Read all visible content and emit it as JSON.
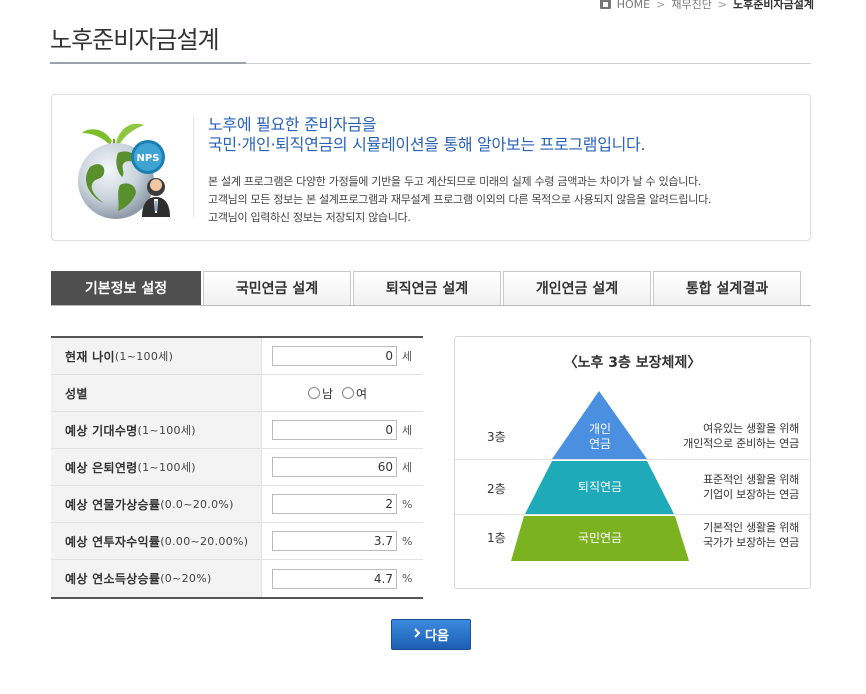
{
  "breadcrumb": {
    "home": "HOME",
    "middle": "재무진단",
    "current": "노후준비자금설계"
  },
  "page_title": "노후준비자금설계",
  "intro": {
    "badge": "NPS",
    "heading_line1": "노후에 필요한 준비자금을",
    "heading_line2": "국민·개인·퇴직연금의 시뮬레이션을 통해 알아보는 프로그램입니다.",
    "desc_line1": "본 설계 프로그램은 다양한 가정들에 기반을 두고 계산되므로 미래의 실제 수령 금액과는 차이가 날 수 있습니다.",
    "desc_line2": "고객님의 모든 정보는 본 설계프로그램과 재무설계 프로그램 이외의 다른 목적으로 사용되지 않음을 알려드립니다.",
    "desc_line3": "고객님이 입력하신 정보는 저장되지 않습니다."
  },
  "tabs": [
    {
      "label": "기본정보 설정",
      "active": true
    },
    {
      "label": "국민연금 설계"
    },
    {
      "label": "퇴직연금 설계"
    },
    {
      "label": "개인연금 설계"
    },
    {
      "label": "통합 설계결과"
    }
  ],
  "form": {
    "current_age": {
      "label": "현재 나이",
      "range": "(1~100세)",
      "value": "0",
      "unit": "세"
    },
    "gender": {
      "label": "성별",
      "male": "남",
      "female": "여"
    },
    "life_expectancy": {
      "label": "예상 기대수명",
      "range": "(1~100세)",
      "value": "0",
      "unit": "세"
    },
    "retire_age": {
      "label": "예상 은퇴연령",
      "range": "(1~100세)",
      "value": "60",
      "unit": "세"
    },
    "inflation": {
      "label": "예상 연물가상승률",
      "range": "(0.0~20.0%)",
      "value": "2",
      "unit": "%"
    },
    "return_rate": {
      "label": "예상 연투자수익률",
      "range": "(0.00~20.00%)",
      "value": "3.7",
      "unit": "%"
    },
    "income_growth": {
      "label": "예상 연소득상승률",
      "range": "(0~20%)",
      "value": "4.7",
      "unit": "%"
    }
  },
  "pyramid": {
    "title": "〈노후 3층 보장체제〉",
    "tiers": [
      {
        "level": "3층",
        "name_line1": "개인",
        "name_line2": "연금",
        "desc_line1": "여유있는 생활을 위해",
        "desc_line2": "개인적으로 준비하는 연금",
        "color": "#4a8fe0"
      },
      {
        "level": "2층",
        "name": "퇴직연금",
        "desc_line1": "표준적인 생활을 위해",
        "desc_line2": "기업이 보장하는 연금",
        "color": "#1eaab8"
      },
      {
        "level": "1층",
        "name": "국민연금",
        "desc_line1": "기본적인 생활을 위해",
        "desc_line2": "국가가 보장하는 연금",
        "color": "#7ab31f"
      }
    ]
  },
  "next_button": {
    "label": "다음",
    "icon": "chevron-right-icon"
  }
}
